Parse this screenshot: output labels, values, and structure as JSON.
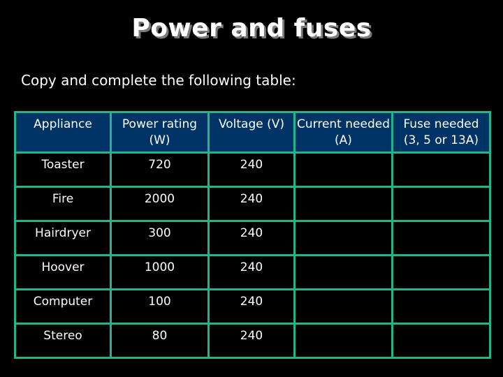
{
  "slide": {
    "title": "Power and fuses",
    "instruction": "Copy and complete the following table:"
  },
  "table": {
    "headers": [
      "Appliance",
      "Power rating (W)",
      "Voltage (V)",
      "Current needed (A)",
      "Fuse needed (3, 5 or 13A)"
    ],
    "rows": [
      {
        "appliance": "Toaster",
        "power": "720",
        "voltage": "240",
        "current": "",
        "fuse": ""
      },
      {
        "appliance": "Fire",
        "power": "2000",
        "voltage": "240",
        "current": "",
        "fuse": ""
      },
      {
        "appliance": "Hairdryer",
        "power": "300",
        "voltage": "240",
        "current": "",
        "fuse": ""
      },
      {
        "appliance": "Hoover",
        "power": "1000",
        "voltage": "240",
        "current": "",
        "fuse": ""
      },
      {
        "appliance": "Computer",
        "power": "100",
        "voltage": "240",
        "current": "",
        "fuse": ""
      },
      {
        "appliance": "Stereo",
        "power": "80",
        "voltage": "240",
        "current": "",
        "fuse": ""
      }
    ]
  },
  "colors": {
    "background": "#000000",
    "header_fill": "#003366",
    "grid_line": "#22b48c",
    "text": "#ffffff"
  }
}
